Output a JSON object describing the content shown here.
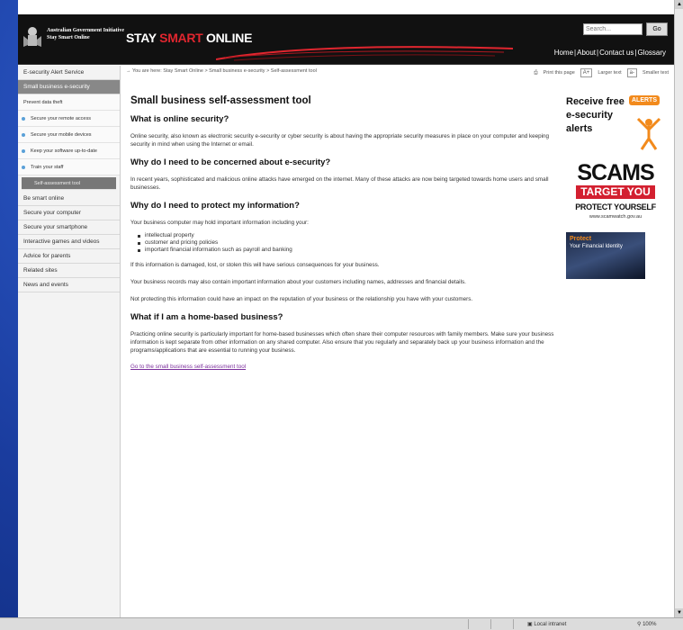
{
  "header": {
    "gov_line1": "Australian Government Initiative",
    "gov_line2": "Stay Smart Online",
    "brand_stay": "STAY",
    "brand_smart": "SMART",
    "brand_online": "ONLINE",
    "search_placeholder": "Search...",
    "go_label": "Go",
    "links": [
      "Home",
      "About",
      "Contact us",
      "Glossary"
    ]
  },
  "sidebar": {
    "items": [
      {
        "label": "E-security Alert Service",
        "type": "item"
      },
      {
        "label": "Small business e-security",
        "type": "active"
      },
      {
        "label": "Prevent data theft",
        "type": "plain"
      },
      {
        "label": "Secure your remote access",
        "type": "sub"
      },
      {
        "label": "Secure your mobile devices",
        "type": "sub"
      },
      {
        "label": "Keep your software up-to-date",
        "type": "sub"
      },
      {
        "label": "Train your staff",
        "type": "sub"
      },
      {
        "label": "Self-assessment tool",
        "type": "selected"
      },
      {
        "label": "Be smart online",
        "type": "item"
      },
      {
        "label": "Secure your computer",
        "type": "item"
      },
      {
        "label": "Secure your smartphone",
        "type": "item"
      },
      {
        "label": "Interactive games and videos",
        "type": "item"
      },
      {
        "label": "Advice for parents",
        "type": "item"
      },
      {
        "label": "Related sites",
        "type": "item"
      },
      {
        "label": "News and events",
        "type": "item"
      }
    ]
  },
  "breadcrumb": {
    "text": "You are here: Stay Smart Online > Small business e-security > Self-assessment tool"
  },
  "tools": {
    "print": "Print this page",
    "larger_box": "A+",
    "larger": "Larger text",
    "smaller_box": "a-",
    "smaller": "Smaller text"
  },
  "content": {
    "title": "Small business self-assessment tool",
    "h_online": "What is online security?",
    "p_online": "Online security, also known as electronic security e-security or cyber security is about having the appropriate security measures in place on your computer and keeping security in mind when using the Internet or email.",
    "h_concerned": "Why do I need to be concerned about e-security?",
    "p_concerned": "In recent years, sophisticated and malicious online attacks have emerged on the internet. Many of these attacks are now being targeted towards home users and small businesses.",
    "h_protect": "Why do I need to protect my information?",
    "p_protect": "Your business computer may hold important information including your:",
    "bullets": [
      "intellectual property",
      "customer and pricing policies",
      "important financial information such as payroll and banking"
    ],
    "p_damaged": "If this information is damaged, lost, or stolen this will have serious consequences for your business.",
    "p_records": "Your business records may also contain important information about your customers including names, addresses and financial details.",
    "p_reputation": "Not protecting this information could have an impact on the reputation of your business or the relationship you have with your customers.",
    "h_home": "What if I am a home-based business?",
    "p_home": "Practicing online security is particularly important for home-based businesses which often share their computer resources with family members. Make sure your business information is kept separate from other information on any shared computer. Also ensure that you regularly and separately back up your business information and the programs/applications that are essential to running your business.",
    "link": "Go to the small business self-assessment tool"
  },
  "right": {
    "alerts_l1": "Receive free",
    "alerts_l2": "e-security",
    "alerts_l3": "alerts",
    "alerts_badge": "ALERTS",
    "scams_title": "SCAMS",
    "scams_target": "TARGET YOU",
    "scams_protect": "PROTECT YOURSELF",
    "scams_url": "www.scamwatch.gov.au",
    "identity_t1": "Protect",
    "identity_t2": "Your Financial Identity"
  },
  "status": {
    "zone": "Local intranet",
    "zoom": "100%"
  },
  "colors": {
    "slide_bg": "#1b3fa8",
    "brand_red": "#e0262f",
    "alerts_orange": "#f28a1c",
    "link_purple": "#7b2f9c"
  }
}
